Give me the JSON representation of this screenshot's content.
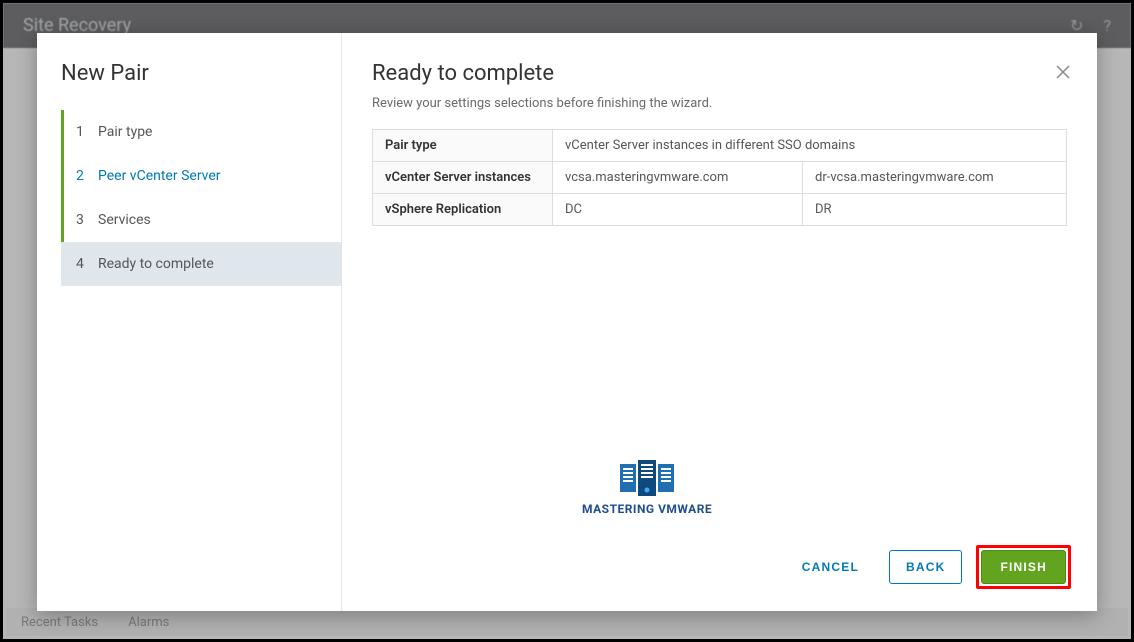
{
  "app": {
    "title": "Site Recovery"
  },
  "bottom": {
    "recent_tasks": "Recent Tasks",
    "alarms": "Alarms"
  },
  "wizard": {
    "title": "New Pair",
    "steps": [
      {
        "num": "1",
        "label": "Pair type"
      },
      {
        "num": "2",
        "label": "Peer vCenter Server"
      },
      {
        "num": "3",
        "label": "Services"
      },
      {
        "num": "4",
        "label": "Ready to complete"
      }
    ]
  },
  "content": {
    "title": "Ready to complete",
    "subtitle": "Review your settings selections before finishing the wizard."
  },
  "summary": {
    "rows": [
      {
        "label": "Pair type",
        "val1": "vCenter Server instances in different SSO domains",
        "val2": ""
      },
      {
        "label": "vCenter Server instances",
        "val1": "vcsa.masteringvmware.com",
        "val2": "dr-vcsa.masteringvmware.com"
      },
      {
        "label": "vSphere Replication",
        "val1": "DC",
        "val2": "DR"
      }
    ]
  },
  "watermark": {
    "text": "MASTERING VMWARE"
  },
  "footer": {
    "cancel": "CANCEL",
    "back": "BACK",
    "finish": "FINISH"
  }
}
